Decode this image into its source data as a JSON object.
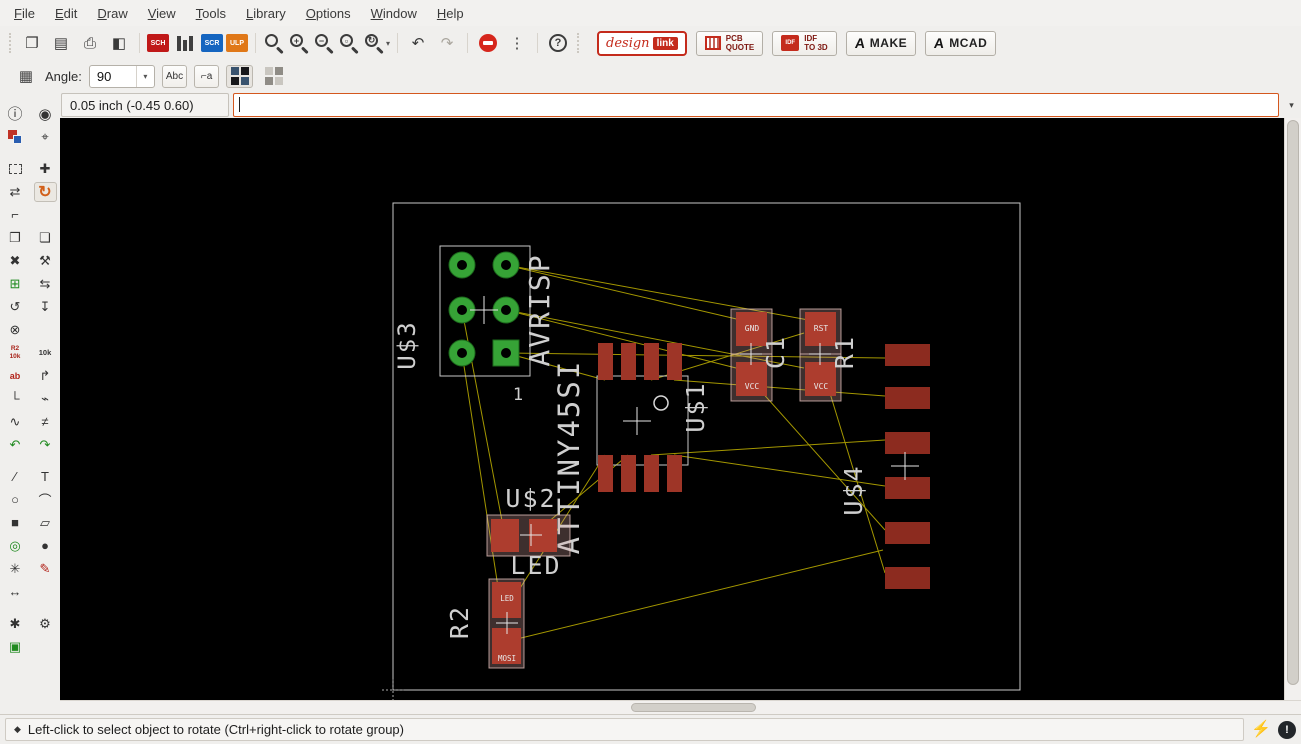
{
  "menubar": {
    "items": [
      "File",
      "Edit",
      "Draw",
      "View",
      "Tools",
      "Library",
      "Options",
      "Window",
      "Help"
    ]
  },
  "toolbar_main": {
    "icons": {
      "open": "❐",
      "save": "▤",
      "print": "⎙",
      "cam": "◧",
      "zoom_fit": "",
      "zoom_in": "+",
      "zoom_out": "−",
      "zoom_select": "▫",
      "zoom_redraw": "↻",
      "undo": "↶",
      "redo": "↷",
      "dots": "⋮",
      "help": "?",
      "chevron": "▾"
    },
    "sch_badge": "SCH",
    "scr_badge": "SCR",
    "ulp_badge": "ULP",
    "brand": {
      "designlink_part1": "design",
      "designlink_part2": "link",
      "pcbquote_line1": "PCB",
      "pcbquote_line2": "QUOTE",
      "idf_badge": "IDF",
      "idf_line1": "IDF",
      "idf_line2": "TO 3D",
      "make_logo": "A",
      "make_label": "MAKE",
      "mcad_logo": "A",
      "mcad_label": "MCAD"
    }
  },
  "toolbar_params": {
    "grid_glyph": "▦",
    "angle_label": "Angle:",
    "angle_value": "90",
    "abc_label": "Abc",
    "mirror_text_glyph": "⌐a"
  },
  "commandbar": {
    "coords": "0.05 inch (-0.45 0.60)",
    "value": ""
  },
  "icons": {
    "info": "ⓘ",
    "eye": "◉",
    "mark": "⌖",
    "move": "✚",
    "mirror": "⇄",
    "rotate": "↻",
    "bend": "⌐",
    "copy": "❐",
    "paste": "❏",
    "delete": "✖",
    "change": "⚒",
    "add": "⊞",
    "pinswap": "⇆",
    "replace": "↺",
    "lock_arrow": "↧",
    "lock": "⊗",
    "name": "ab",
    "optimize": "↱",
    "route": "└",
    "ripup": "⌁",
    "meander": "∿",
    "split": "≠",
    "curve_left": "↶",
    "curve_right": "↷",
    "wire": "∕",
    "text": "T",
    "circle": "○",
    "arc": "⌒",
    "rect": "■",
    "polygon": "▱",
    "via": "◎",
    "hole": "●",
    "ratsnest": "✳",
    "signal": "✎",
    "width": "↔",
    "auto": "✱",
    "drc": "⚙",
    "errors": "▣"
  },
  "sidebar": {
    "smash_top": "R2",
    "smash_bottom": "10k",
    "value_text": "10k"
  },
  "board": {
    "refs": {
      "u3": "U$3",
      "avrisp": "AVRISP",
      "pin1": "1",
      "attiny": "ATTINY45SI",
      "u1": "U$1",
      "u2": "U$2",
      "led": "LED",
      "r2": "R2",
      "c1": "C1",
      "r1": "R1",
      "u4": "U$4"
    },
    "nets": {
      "c1_top": "GND",
      "c1_bottom": "VCC",
      "r1_top": "RST",
      "r1_bottom": "VCC",
      "r2_top": "LED",
      "r2_bottom": "MOSI"
    },
    "colors": {
      "airwire": "#b6a800",
      "pad_green": "#36a336",
      "pad_red": "#ad3d2e",
      "outline": "#c8c8c8"
    }
  },
  "statusbar": {
    "bullet": "◆",
    "text": "Left-click to select object to rotate (Ctrl+right-click to rotate group)",
    "bolt_glyph": "⚡",
    "alert_glyph": "!"
  }
}
